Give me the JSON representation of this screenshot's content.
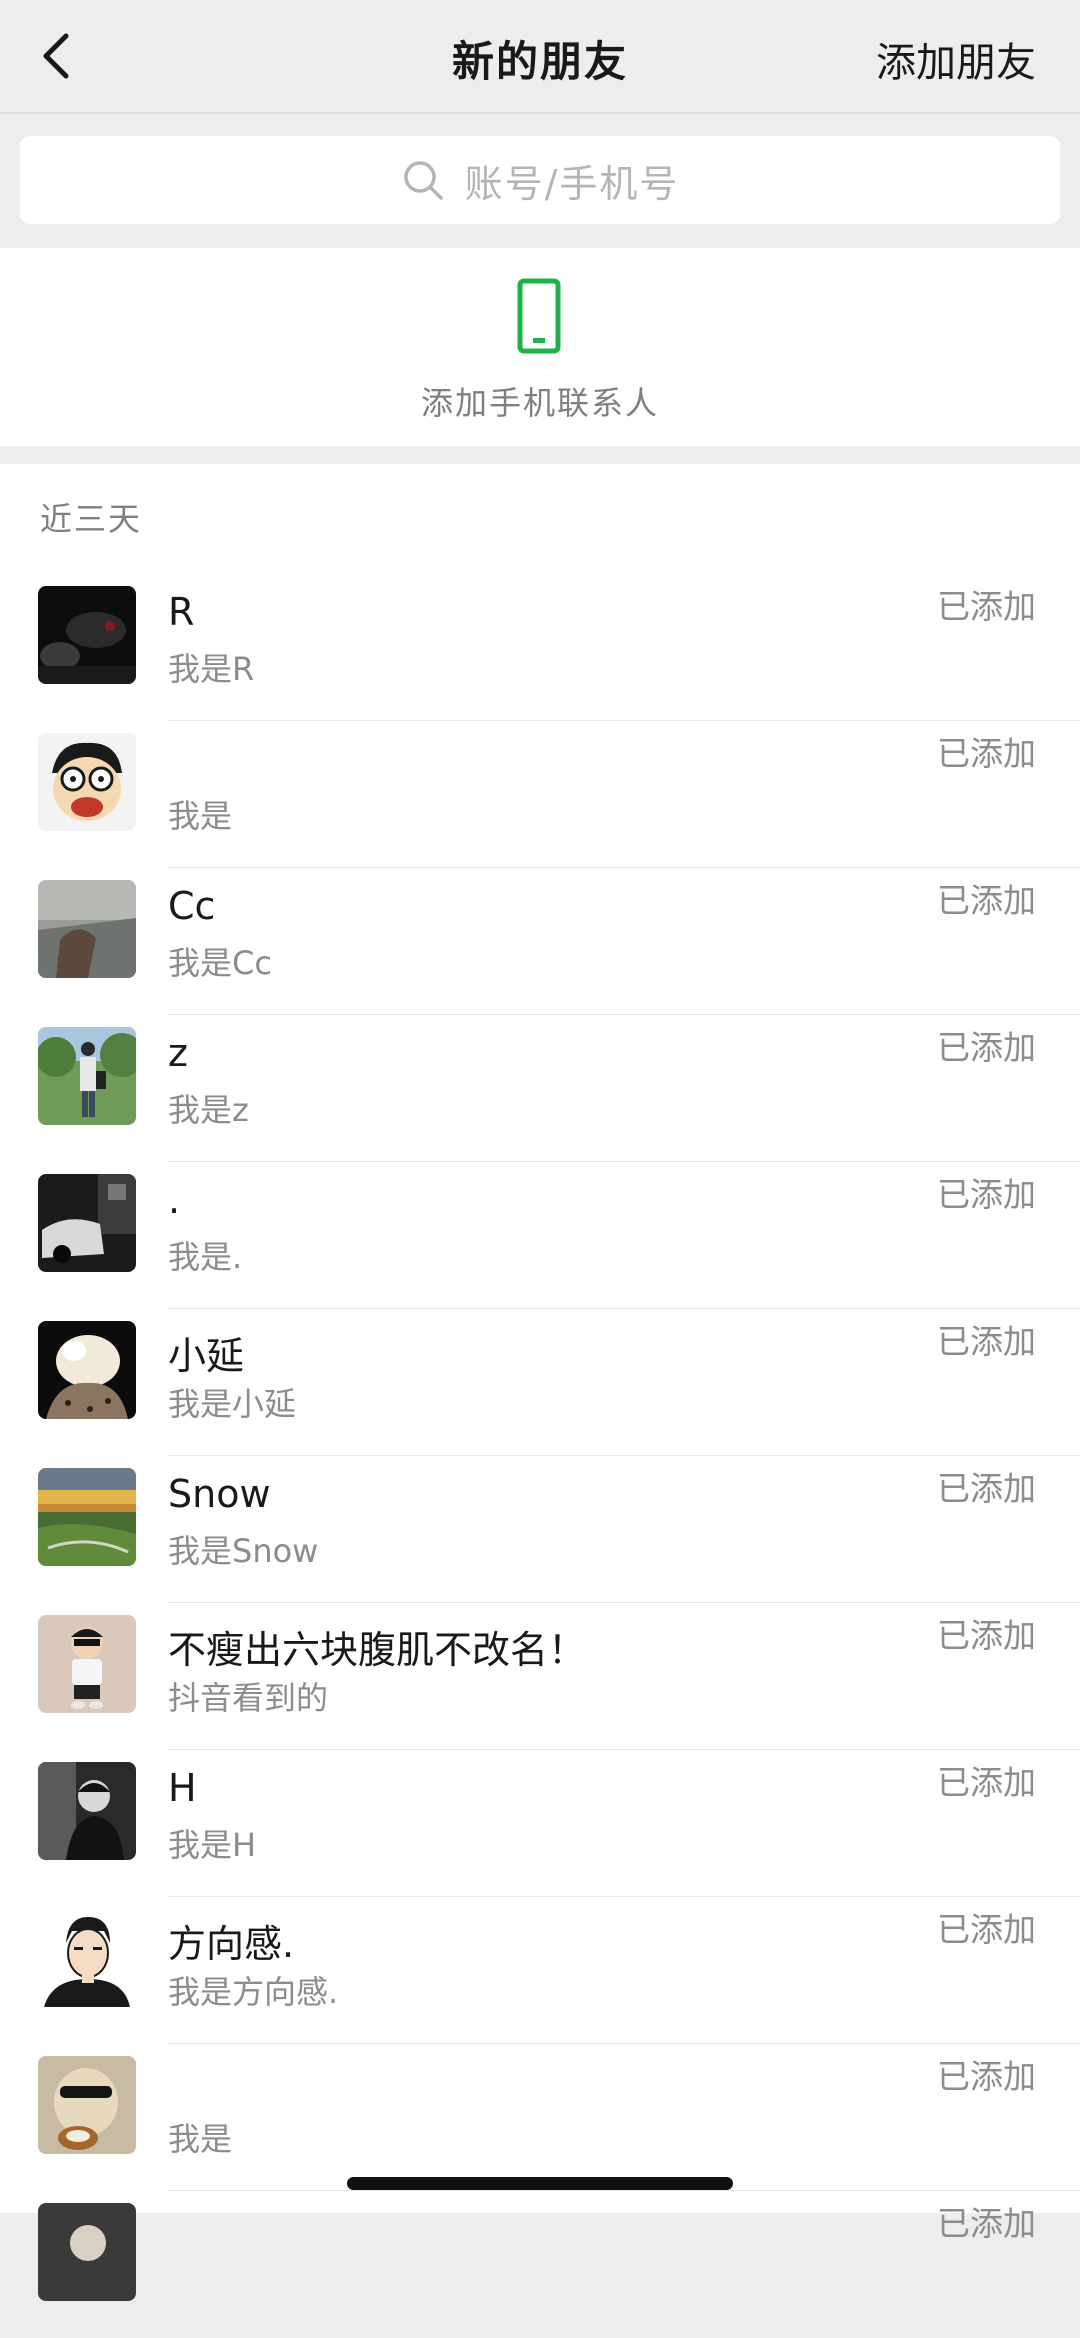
{
  "nav": {
    "title": "新的朋友",
    "action": "添加朋友"
  },
  "search": {
    "placeholder": "账号/手机号"
  },
  "phone_contacts": {
    "label": "添加手机联系人",
    "icon": "phone-icon",
    "accent_color": "#20b24a"
  },
  "section": {
    "header": "近三天"
  },
  "requests": [
    {
      "name": "R",
      "message": "我是R",
      "status": "已添加"
    },
    {
      "name": "",
      "message": "我是",
      "status": "已添加"
    },
    {
      "name": "Cc",
      "message": "我是Cc",
      "status": "已添加"
    },
    {
      "name": "z",
      "message": "我是z",
      "status": "已添加"
    },
    {
      "name": ".",
      "message": "我是.",
      "status": "已添加"
    },
    {
      "name": "小延",
      "message": "我是小延",
      "status": "已添加"
    },
    {
      "name": "Snow",
      "message": "我是Snow",
      "status": "已添加"
    },
    {
      "name": "不瘦出六块腹肌不改名！",
      "message": "抖音看到的",
      "status": "已添加"
    },
    {
      "name": "H",
      "message": "我是H",
      "status": "已添加"
    },
    {
      "name": "方向感.",
      "message": "我是方向感.",
      "status": "已添加"
    },
    {
      "name": "",
      "message": "我是",
      "status": "已添加"
    },
    {
      "name": "",
      "message": "",
      "status": "已添加"
    }
  ]
}
